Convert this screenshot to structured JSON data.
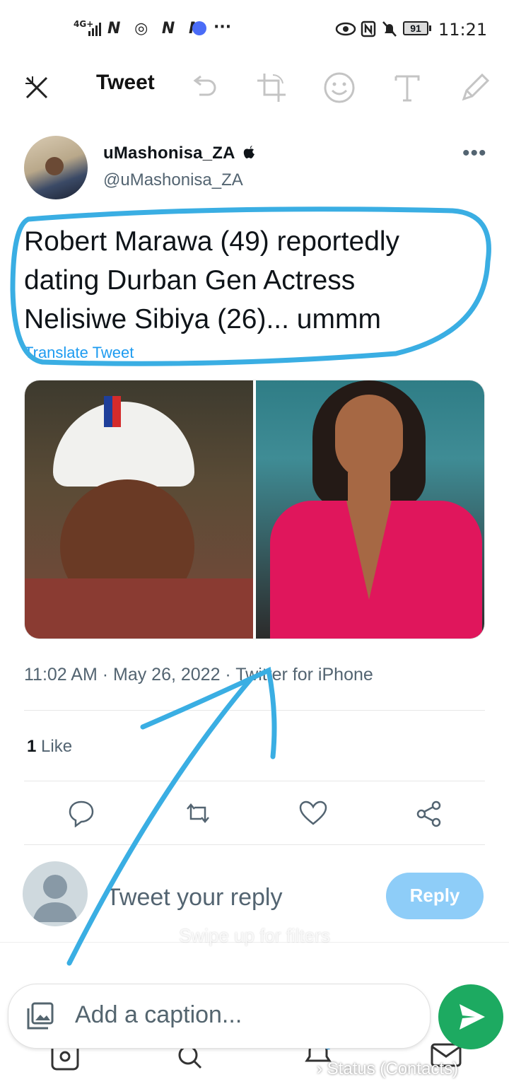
{
  "status_bar": {
    "network": "4G+",
    "notification_letters": "N ◎ N N",
    "more": "···",
    "battery": "91",
    "time": "11:21"
  },
  "editor_toolbar": {
    "title": "Tweet",
    "icons": [
      "crop-close-icon",
      "undo-icon",
      "crop-rotate-icon",
      "emoji-icon",
      "text-icon",
      "pencil-icon"
    ]
  },
  "tweet": {
    "author_name": "uMashonisa_ZA",
    "author_handle": "@uMashonisa_ZA",
    "text_lines": [
      "Robert Marawa (49) reportedly",
      "dating Durban Gen Actress",
      "Nelisiwe Sibiya (26)... ummm"
    ],
    "translate_label": "Translate Tweet",
    "timestamp": "11:02 AM · May 26, 2022 · Twitter for iPhone",
    "likes_count": "1",
    "likes_label": "Like"
  },
  "reply": {
    "placeholder": "Tweet your reply",
    "button_label": "Reply"
  },
  "editor_overlay": {
    "swipe_hint": "Swipe up for filters",
    "caption_placeholder": "Add a caption...",
    "status_label": "Status (Contacts)"
  },
  "colors": {
    "accent": "#1d9bf0",
    "highlight_stroke": "#3aaee3",
    "send_green": "#1daa61",
    "reply_button": "#8ecdf8"
  }
}
